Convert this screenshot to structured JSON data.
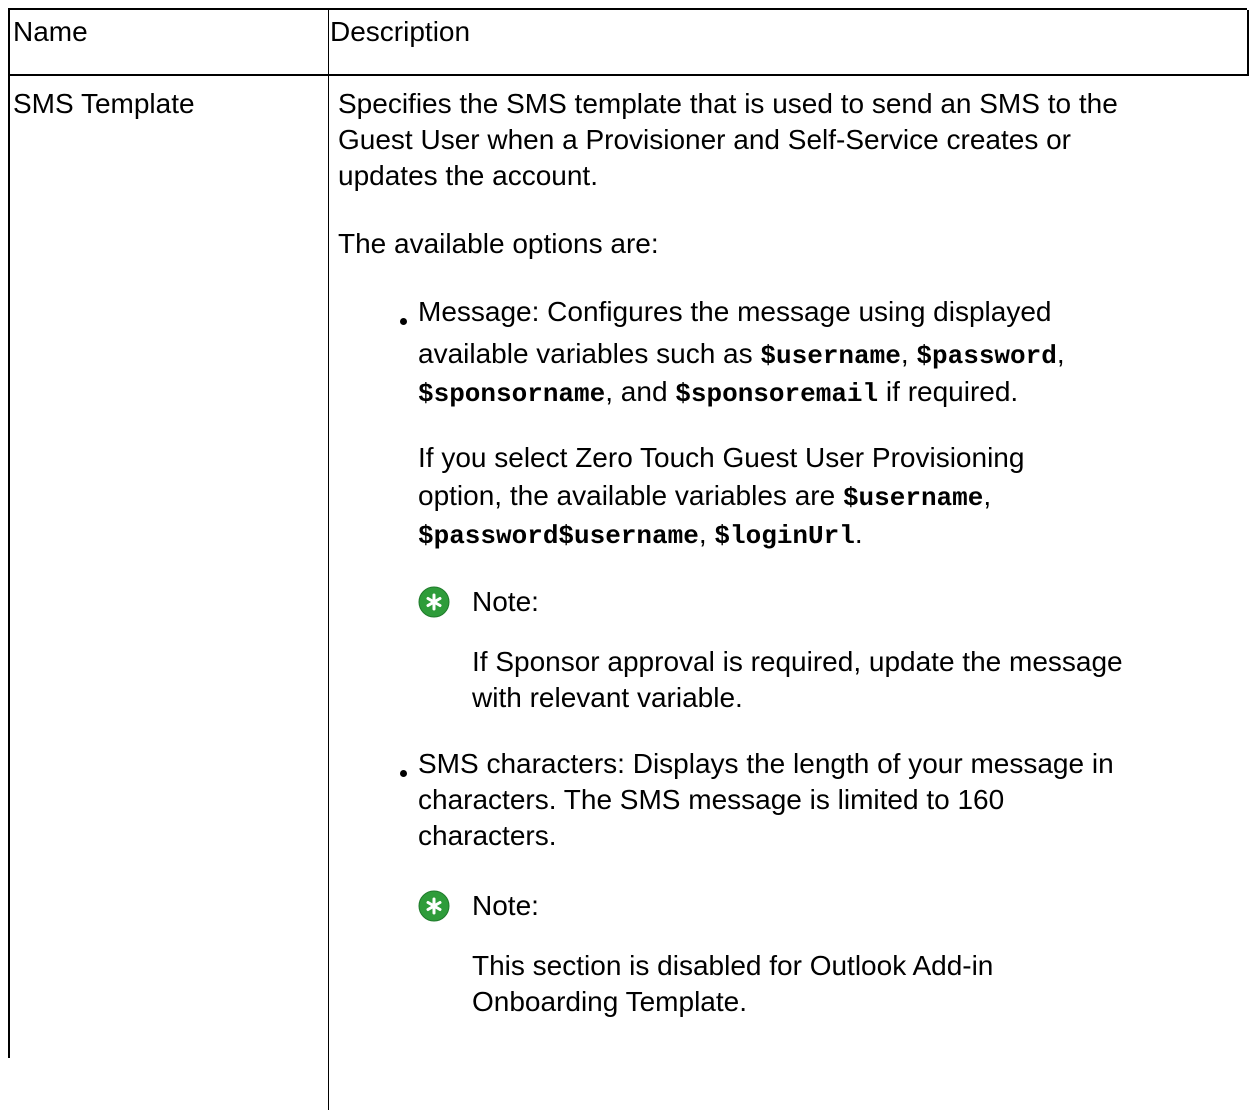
{
  "table": {
    "headers": {
      "name": "Name",
      "description": "Description"
    },
    "row": {
      "name": "SMS Template",
      "intro_lines": [
        "Specifies the SMS template that is used to send an SMS to the",
        "Guest User when a Provisioner and Self-Service creates or",
        "updates the account."
      ],
      "options_intro": "The available options are:",
      "options": [
        {
          "term": "Message",
          "text_a": ": Configures the message using displayed",
          "text_b": "available variables such as ",
          "var1": "$username",
          "sep1": ", ",
          "var2": "$password",
          "sep2": ",",
          "var3": "$sponsorname",
          "sep3": ", and ",
          "var4": "$sponsoremail",
          "text_c": " if required.",
          "zt_prefix": "If you select ",
          "zt_term": "Zero Touch Guest User Provisioning",
          "zt_text": "option, the available variables are ",
          "zt_var1": "$username",
          "zt_sep1": ",",
          "zt_var2": "$password$username",
          "zt_sep2": ", ",
          "zt_var3": "$loginUrl",
          "zt_end": ".",
          "note_label": "Note:",
          "note_lines": [
            "If Sponsor approval is required, update the message",
            "with relevant variable."
          ]
        },
        {
          "term": "SMS characters",
          "text_a": ": Displays the length of your message in",
          "lines": [
            "characters. The SMS message is limited to 160",
            "characters."
          ],
          "note_label": "Note:",
          "note_lines": [
            "This section is disabled for Outlook Add-in",
            "Onboarding Template."
          ]
        }
      ]
    }
  },
  "colors": {
    "note_icon_fill": "#2e9c3a",
    "border": "#000000"
  },
  "icons": {
    "note": "asterisk-circle-icon"
  }
}
